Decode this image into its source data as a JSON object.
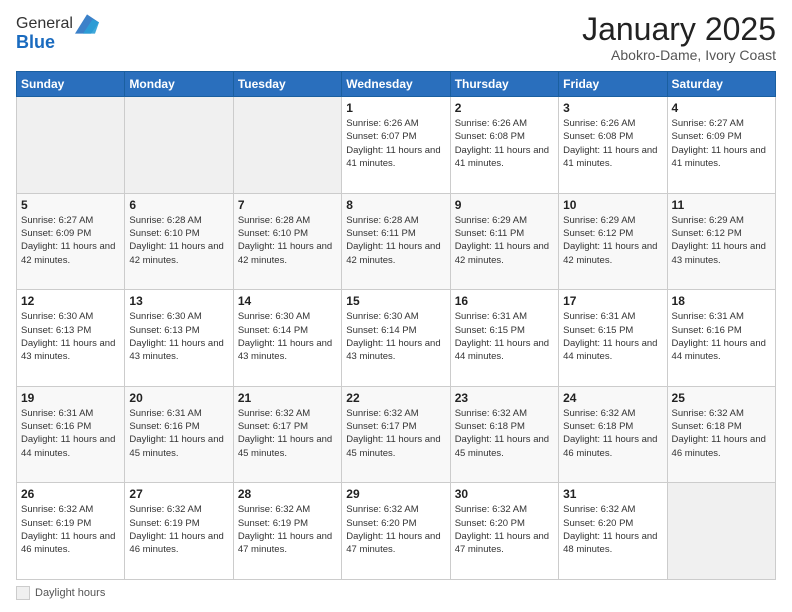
{
  "logo": {
    "general": "General",
    "blue": "Blue"
  },
  "header": {
    "month": "January 2025",
    "location": "Abokro-Dame, Ivory Coast"
  },
  "days_of_week": [
    "Sunday",
    "Monday",
    "Tuesday",
    "Wednesday",
    "Thursday",
    "Friday",
    "Saturday"
  ],
  "legend": {
    "label": "Daylight hours"
  },
  "weeks": [
    [
      {
        "day": "",
        "info": ""
      },
      {
        "day": "",
        "info": ""
      },
      {
        "day": "",
        "info": ""
      },
      {
        "day": "1",
        "info": "Sunrise: 6:26 AM\nSunset: 6:07 PM\nDaylight: 11 hours and 41 minutes."
      },
      {
        "day": "2",
        "info": "Sunrise: 6:26 AM\nSunset: 6:08 PM\nDaylight: 11 hours and 41 minutes."
      },
      {
        "day": "3",
        "info": "Sunrise: 6:26 AM\nSunset: 6:08 PM\nDaylight: 11 hours and 41 minutes."
      },
      {
        "day": "4",
        "info": "Sunrise: 6:27 AM\nSunset: 6:09 PM\nDaylight: 11 hours and 41 minutes."
      }
    ],
    [
      {
        "day": "5",
        "info": "Sunrise: 6:27 AM\nSunset: 6:09 PM\nDaylight: 11 hours and 42 minutes."
      },
      {
        "day": "6",
        "info": "Sunrise: 6:28 AM\nSunset: 6:10 PM\nDaylight: 11 hours and 42 minutes."
      },
      {
        "day": "7",
        "info": "Sunrise: 6:28 AM\nSunset: 6:10 PM\nDaylight: 11 hours and 42 minutes."
      },
      {
        "day": "8",
        "info": "Sunrise: 6:28 AM\nSunset: 6:11 PM\nDaylight: 11 hours and 42 minutes."
      },
      {
        "day": "9",
        "info": "Sunrise: 6:29 AM\nSunset: 6:11 PM\nDaylight: 11 hours and 42 minutes."
      },
      {
        "day": "10",
        "info": "Sunrise: 6:29 AM\nSunset: 6:12 PM\nDaylight: 11 hours and 42 minutes."
      },
      {
        "day": "11",
        "info": "Sunrise: 6:29 AM\nSunset: 6:12 PM\nDaylight: 11 hours and 43 minutes."
      }
    ],
    [
      {
        "day": "12",
        "info": "Sunrise: 6:30 AM\nSunset: 6:13 PM\nDaylight: 11 hours and 43 minutes."
      },
      {
        "day": "13",
        "info": "Sunrise: 6:30 AM\nSunset: 6:13 PM\nDaylight: 11 hours and 43 minutes."
      },
      {
        "day": "14",
        "info": "Sunrise: 6:30 AM\nSunset: 6:14 PM\nDaylight: 11 hours and 43 minutes."
      },
      {
        "day": "15",
        "info": "Sunrise: 6:30 AM\nSunset: 6:14 PM\nDaylight: 11 hours and 43 minutes."
      },
      {
        "day": "16",
        "info": "Sunrise: 6:31 AM\nSunset: 6:15 PM\nDaylight: 11 hours and 44 minutes."
      },
      {
        "day": "17",
        "info": "Sunrise: 6:31 AM\nSunset: 6:15 PM\nDaylight: 11 hours and 44 minutes."
      },
      {
        "day": "18",
        "info": "Sunrise: 6:31 AM\nSunset: 6:16 PM\nDaylight: 11 hours and 44 minutes."
      }
    ],
    [
      {
        "day": "19",
        "info": "Sunrise: 6:31 AM\nSunset: 6:16 PM\nDaylight: 11 hours and 44 minutes."
      },
      {
        "day": "20",
        "info": "Sunrise: 6:31 AM\nSunset: 6:16 PM\nDaylight: 11 hours and 45 minutes."
      },
      {
        "day": "21",
        "info": "Sunrise: 6:32 AM\nSunset: 6:17 PM\nDaylight: 11 hours and 45 minutes."
      },
      {
        "day": "22",
        "info": "Sunrise: 6:32 AM\nSunset: 6:17 PM\nDaylight: 11 hours and 45 minutes."
      },
      {
        "day": "23",
        "info": "Sunrise: 6:32 AM\nSunset: 6:18 PM\nDaylight: 11 hours and 45 minutes."
      },
      {
        "day": "24",
        "info": "Sunrise: 6:32 AM\nSunset: 6:18 PM\nDaylight: 11 hours and 46 minutes."
      },
      {
        "day": "25",
        "info": "Sunrise: 6:32 AM\nSunset: 6:18 PM\nDaylight: 11 hours and 46 minutes."
      }
    ],
    [
      {
        "day": "26",
        "info": "Sunrise: 6:32 AM\nSunset: 6:19 PM\nDaylight: 11 hours and 46 minutes."
      },
      {
        "day": "27",
        "info": "Sunrise: 6:32 AM\nSunset: 6:19 PM\nDaylight: 11 hours and 46 minutes."
      },
      {
        "day": "28",
        "info": "Sunrise: 6:32 AM\nSunset: 6:19 PM\nDaylight: 11 hours and 47 minutes."
      },
      {
        "day": "29",
        "info": "Sunrise: 6:32 AM\nSunset: 6:20 PM\nDaylight: 11 hours and 47 minutes."
      },
      {
        "day": "30",
        "info": "Sunrise: 6:32 AM\nSunset: 6:20 PM\nDaylight: 11 hours and 47 minutes."
      },
      {
        "day": "31",
        "info": "Sunrise: 6:32 AM\nSunset: 6:20 PM\nDaylight: 11 hours and 48 minutes."
      },
      {
        "day": "",
        "info": ""
      }
    ]
  ]
}
